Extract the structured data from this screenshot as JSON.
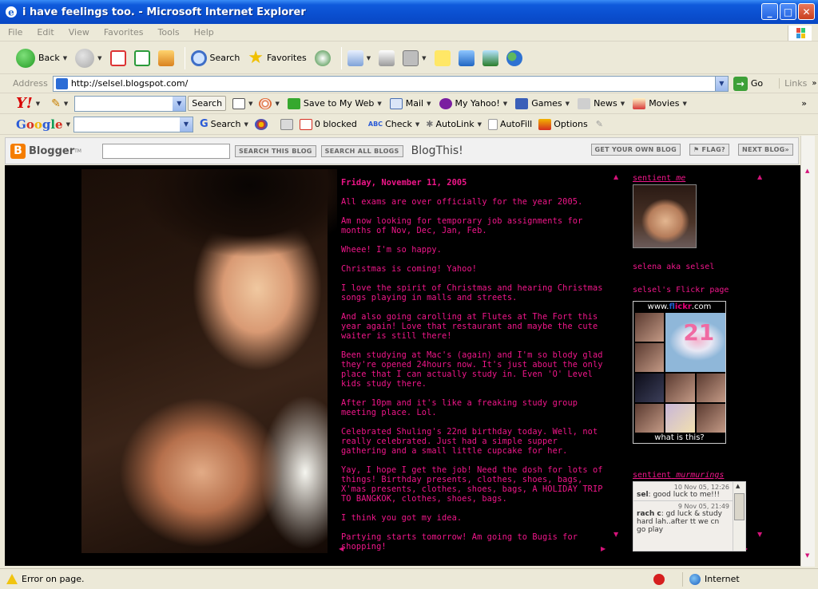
{
  "window": {
    "title": "i have feelings too. - Microsoft Internet Explorer"
  },
  "menu": [
    "File",
    "Edit",
    "View",
    "Favorites",
    "Tools",
    "Help"
  ],
  "toolbar": {
    "back": "Back",
    "search": "Search",
    "favorites": "Favorites"
  },
  "address": {
    "label": "Address",
    "url": "http://selsel.blogspot.com/",
    "go": "Go",
    "links": "Links"
  },
  "yahoo": {
    "logo": "Y!",
    "search_btn": "Search",
    "save": "Save to My Web",
    "mail": "Mail",
    "myyahoo": "My Yahoo!",
    "games": "Games",
    "news": "News",
    "movies": "Movies"
  },
  "google": {
    "logo": "Google",
    "search": "Search",
    "blocked": "0 blocked",
    "check": "Check",
    "autolink": "AutoLink",
    "autofill": "AutoFill",
    "options": "Options"
  },
  "blogger": {
    "logo": "Blogger",
    "tm": "TM",
    "search_blog": "SEARCH THIS BLOG",
    "search_all": "SEARCH ALL BLOGS",
    "blogthis": "BlogThis!",
    "get_own": "GET YOUR OWN BLOG",
    "flag": "FLAG?",
    "next": "NEXT BLOG»"
  },
  "post": {
    "date": "Friday, November 11, 2005",
    "paragraphs": [
      "All exams are over officially for the year 2005.",
      "Am now looking for temporary job assignments for months of Nov, Dec, Jan, Feb.",
      "Wheee! I'm so happy.",
      "Christmas is coming! Yahoo!",
      "I love the spirit of Christmas and hearing Christmas songs playing in malls and streets.",
      "And also going carolling at Flutes at The Fort this year again! Love that restaurant and maybe the cute waiter is still there!",
      "Been studying at Mac's (again) and I'm so blody glad they're opened 24hours now. It's just about the only place that I can actually study in. Even 'O' Level kids study there.",
      "After 10pm and it's like a freaking study group meeting place. Lol.",
      "Celebrated Shuling's 22nd birthday today. Well, not really celebrated. Just had a simple supper gathering and a small little cupcake for her.",
      "Yay, I hope I get the job! Need the dosh for lots of things! Birthday presents, clothes, shoes, bags, X'mas presents, clothes, shoes, bags, A HOLIDAY TRIP TO BANGKOK, clothes, shoes, bags.",
      "I think you got my idea.",
      "Partying starts tomorrow! Am going to Bugis for shopping!"
    ]
  },
  "sidebar": {
    "heading1_a": "sentient",
    "heading1_b": "me",
    "name": "selena aka selsel",
    "flickr_link": "selsel's Flickr page",
    "flickr_head_pre": "www.",
    "flickr_fl": "fl",
    "flickr_ickr": "ickr",
    "flickr_head_post": ".com",
    "cake_number": "21",
    "flickr_foot": "what is this?",
    "heading2_a": "sentient",
    "heading2_b": "murmurings",
    "shouts": [
      {
        "time": "10 Nov 05, 12:26",
        "author": "sel",
        "text": ": good luck to me!!!"
      },
      {
        "time": "9 Nov 05, 21:49",
        "author": "rach c",
        "text": ": gd luck & study hard lah..after tt we cn go play"
      }
    ]
  },
  "status": {
    "text": "Error on page.",
    "zone": "Internet"
  }
}
